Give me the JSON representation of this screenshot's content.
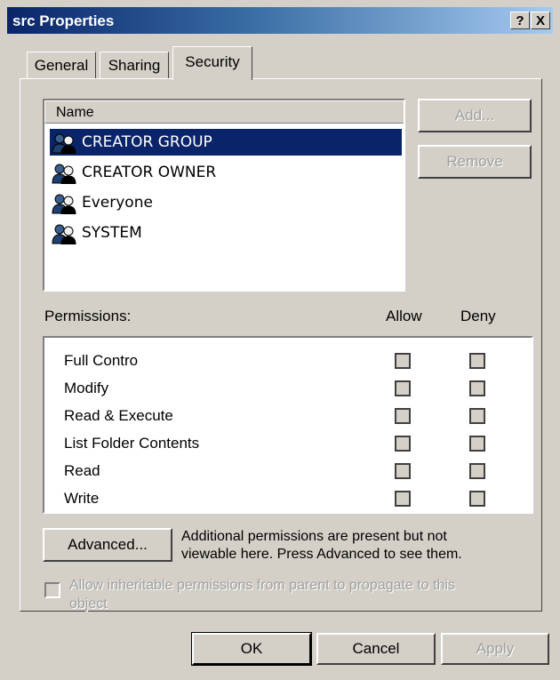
{
  "window": {
    "title": "src Properties",
    "help_label": "?",
    "close_label": "X"
  },
  "tabs": [
    {
      "label": "General"
    },
    {
      "label": "Sharing"
    },
    {
      "label": "Security",
      "active": true
    }
  ],
  "users": {
    "header": "Name",
    "items": [
      {
        "name": "CREATOR GROUP",
        "selected": true
      },
      {
        "name": "CREATOR OWNER"
      },
      {
        "name": "Everyone"
      },
      {
        "name": "SYSTEM"
      }
    ],
    "add_label": "Add...",
    "remove_label": "Remove"
  },
  "permissions": {
    "header": "Permissions:",
    "allow_label": "Allow",
    "deny_label": "Deny",
    "rows": [
      {
        "label": "Full Contro",
        "allow": false,
        "deny": false
      },
      {
        "label": "Modify",
        "allow": false,
        "deny": false
      },
      {
        "label": "Read & Execute",
        "allow": false,
        "deny": false
      },
      {
        "label": "List Folder Contents",
        "allow": false,
        "deny": false
      },
      {
        "label": "Read",
        "allow": false,
        "deny": false
      },
      {
        "label": "Write",
        "allow": false,
        "deny": false
      }
    ]
  },
  "advanced": {
    "button_label": "Advanced...",
    "note_line1": "Additional permissions are present but not",
    "note_line2": "viewable here. Press Advanced to see them."
  },
  "inherit": {
    "label_line1": "Allow inheritable permissions from parent to propagate to this",
    "label_line2": "object",
    "checked": false
  },
  "footer": {
    "ok_label": "OK",
    "cancel_label": "Cancel",
    "apply_label": "Apply"
  }
}
